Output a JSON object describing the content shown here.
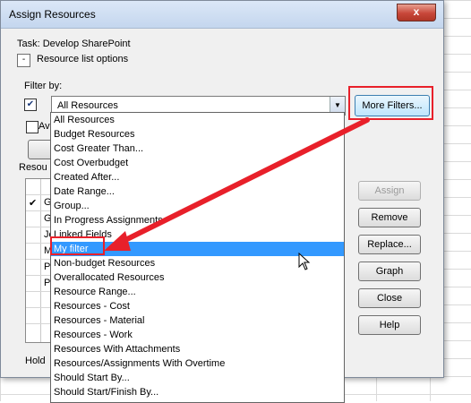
{
  "window": {
    "title": "Assign Resources",
    "close_glyph": "x"
  },
  "task_line": "Task: Develop SharePoint",
  "resource_list_options": {
    "toggle_glyph": "-",
    "label": "Resource list options"
  },
  "filter": {
    "label": "Filter by:",
    "checked": true,
    "selected": "All Resources",
    "more_filters_label": "More Filters..."
  },
  "available_stub": "Ava",
  "resources_stub": "Resou",
  "grid_rows": [
    {
      "check": "✔",
      "text": "G"
    },
    {
      "check": "",
      "text": "G"
    },
    {
      "check": "",
      "text": "Jc"
    },
    {
      "check": "",
      "text": "M"
    },
    {
      "check": "",
      "text": "Pi"
    },
    {
      "check": "",
      "text": "Pc"
    }
  ],
  "hold_stub": "Hold",
  "buttons": {
    "assign": "Assign",
    "remove": "Remove",
    "replace": "Replace...",
    "graph": "Graph",
    "close": "Close",
    "help": "Help"
  },
  "dropdown_items": [
    "All Resources",
    "Budget Resources",
    "Cost Greater Than...",
    "Cost Overbudget",
    "Created After...",
    "Date Range...",
    "Group...",
    "In Progress Assignments",
    "Linked Fields",
    "My filter",
    "Non-budget Resources",
    "Overallocated Resources",
    "Resource Range...",
    "Resources - Cost",
    "Resources - Material",
    "Resources - Work",
    "Resources With Attachments",
    "Resources/Assignments With Overtime",
    "Should Start By...",
    "Should Start/Finish By..."
  ],
  "highlighted_item_index": 9,
  "colors": {
    "annotation": "#e8202a",
    "highlight": "#3399ff"
  }
}
